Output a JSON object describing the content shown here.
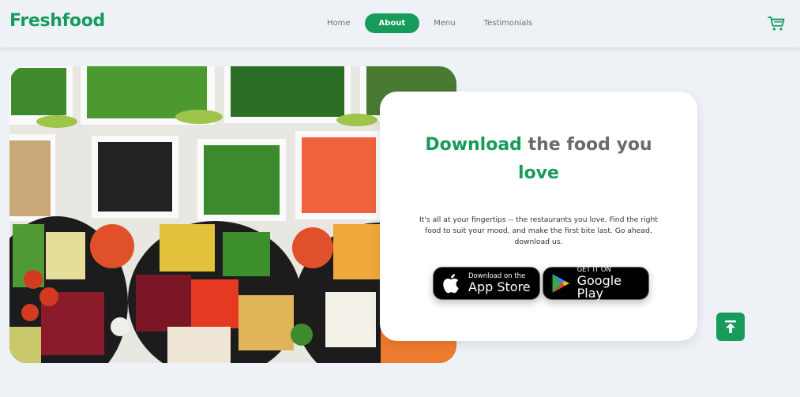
{
  "header": {
    "logo": "Freshfood",
    "nav": [
      {
        "label": "Home",
        "active": false
      },
      {
        "label": "About",
        "active": true
      },
      {
        "label": "Menu",
        "active": false
      },
      {
        "label": "Testimonials",
        "active": false
      }
    ],
    "cart_icon": "shopping-cart-icon"
  },
  "hero": {
    "image_icon": "food-platter-photo",
    "title_highlight_1": "Download",
    "title_rest_1": " the food you",
    "title_highlight_2": "love",
    "description": "It's all at your fingertips -- the restaurants you love. Find the right food to suit your mood, and make the first bite last. Go ahead, download us.",
    "app_store": {
      "small": "Download on the",
      "big": "App Store",
      "icon": "apple-icon"
    },
    "google_play": {
      "small": "GET IT ON",
      "big": "Google Play",
      "icon": "play-store-icon"
    }
  },
  "scroll_top_icon": "arrow-to-top-icon",
  "colors": {
    "accent": "#169b5b",
    "background": "#eef2f7",
    "title_gray": "#6b6b6b"
  }
}
